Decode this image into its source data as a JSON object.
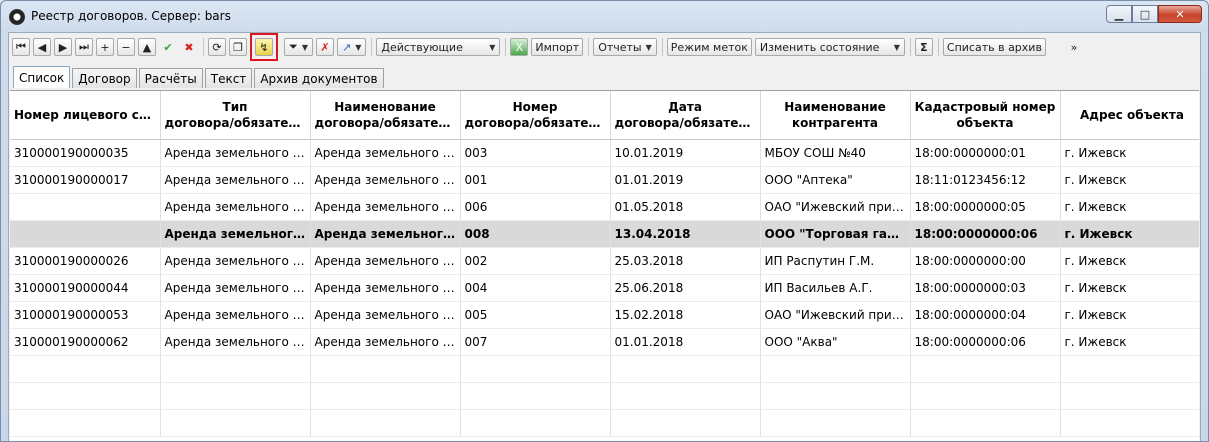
{
  "window": {
    "title": "Реестр договоров. Сервер: bars"
  },
  "toolbar": {
    "filter_select": "Действующие",
    "import_label": "Импорт",
    "reports_label": "Отчеты",
    "mark_mode_label": "Режим меток",
    "change_state_label": "Изменить состояние",
    "sum_label": "Σ",
    "archive_label": "Списать в архив",
    "more_label": "»"
  },
  "tabs": [
    "Список",
    "Договор",
    "Расчёты",
    "Текст",
    "Архив документов"
  ],
  "table": {
    "columns": [
      [
        "Номер лицевого счёта",
        ""
      ],
      [
        "Тип",
        "договора/обязательс..."
      ],
      [
        "Наименование",
        "договора/обязательс..."
      ],
      [
        "Номер",
        "договора/обязательс..."
      ],
      [
        "Дата",
        "договора/обязательс..."
      ],
      [
        "Наименование",
        "контрагента"
      ],
      [
        "Кадастровый номер",
        "объекта"
      ],
      [
        "Адрес объекта",
        ""
      ]
    ],
    "rows": [
      [
        "310000190000035",
        "Аренда земельного уча...",
        "Аренда земельного уча...",
        "003",
        "10.01.2019",
        "МБОУ СОШ №40",
        "18:00:0000000:01",
        "г. Ижевск"
      ],
      [
        "310000190000017",
        "Аренда земельного уча...",
        "Аренда земельного уча...",
        "001",
        "01.01.2019",
        "ООО \"Аптека\"",
        "18:11:0123456:12",
        "г. Ижевск"
      ],
      [
        "",
        "Аренда земельного уча...",
        "Аренда земельного уча...",
        "006",
        "01.05.2018",
        "ОАО \"Ижевский прибо...",
        "18:00:0000000:05",
        "г. Ижевск"
      ],
      [
        "",
        "Аренда земельного у...",
        "Аренда земельного у...",
        "008",
        "13.04.2018",
        "ООО \"Торговая галер...",
        "18:00:0000000:06",
        "г. Ижевск"
      ],
      [
        "310000190000026",
        "Аренда земельного уча...",
        "Аренда земельного уча...",
        "002",
        "25.03.2018",
        "ИП Распутин Г.М.",
        "18:00:0000000:00",
        "г. Ижевск"
      ],
      [
        "310000190000044",
        "Аренда земельного уча...",
        "Аренда земельного уча...",
        "004",
        "25.06.2018",
        "ИП Васильев А.Г.",
        "18:00:0000000:03",
        "г. Ижевск"
      ],
      [
        "310000190000053",
        "Аренда земельного уча...",
        "Аренда земельного уча...",
        "005",
        "15.02.2018",
        "ОАО \"Ижевский прибо...",
        "18:00:0000000:04",
        "г. Ижевск"
      ],
      [
        "310000190000062",
        "Аренда земельного уча...",
        "Аренда земельного уча...",
        "007",
        "01.01.2018",
        "ООО \"Аква\"",
        "18:00:0000000:06",
        "г. Ижевск"
      ]
    ],
    "selected_row": 3
  }
}
